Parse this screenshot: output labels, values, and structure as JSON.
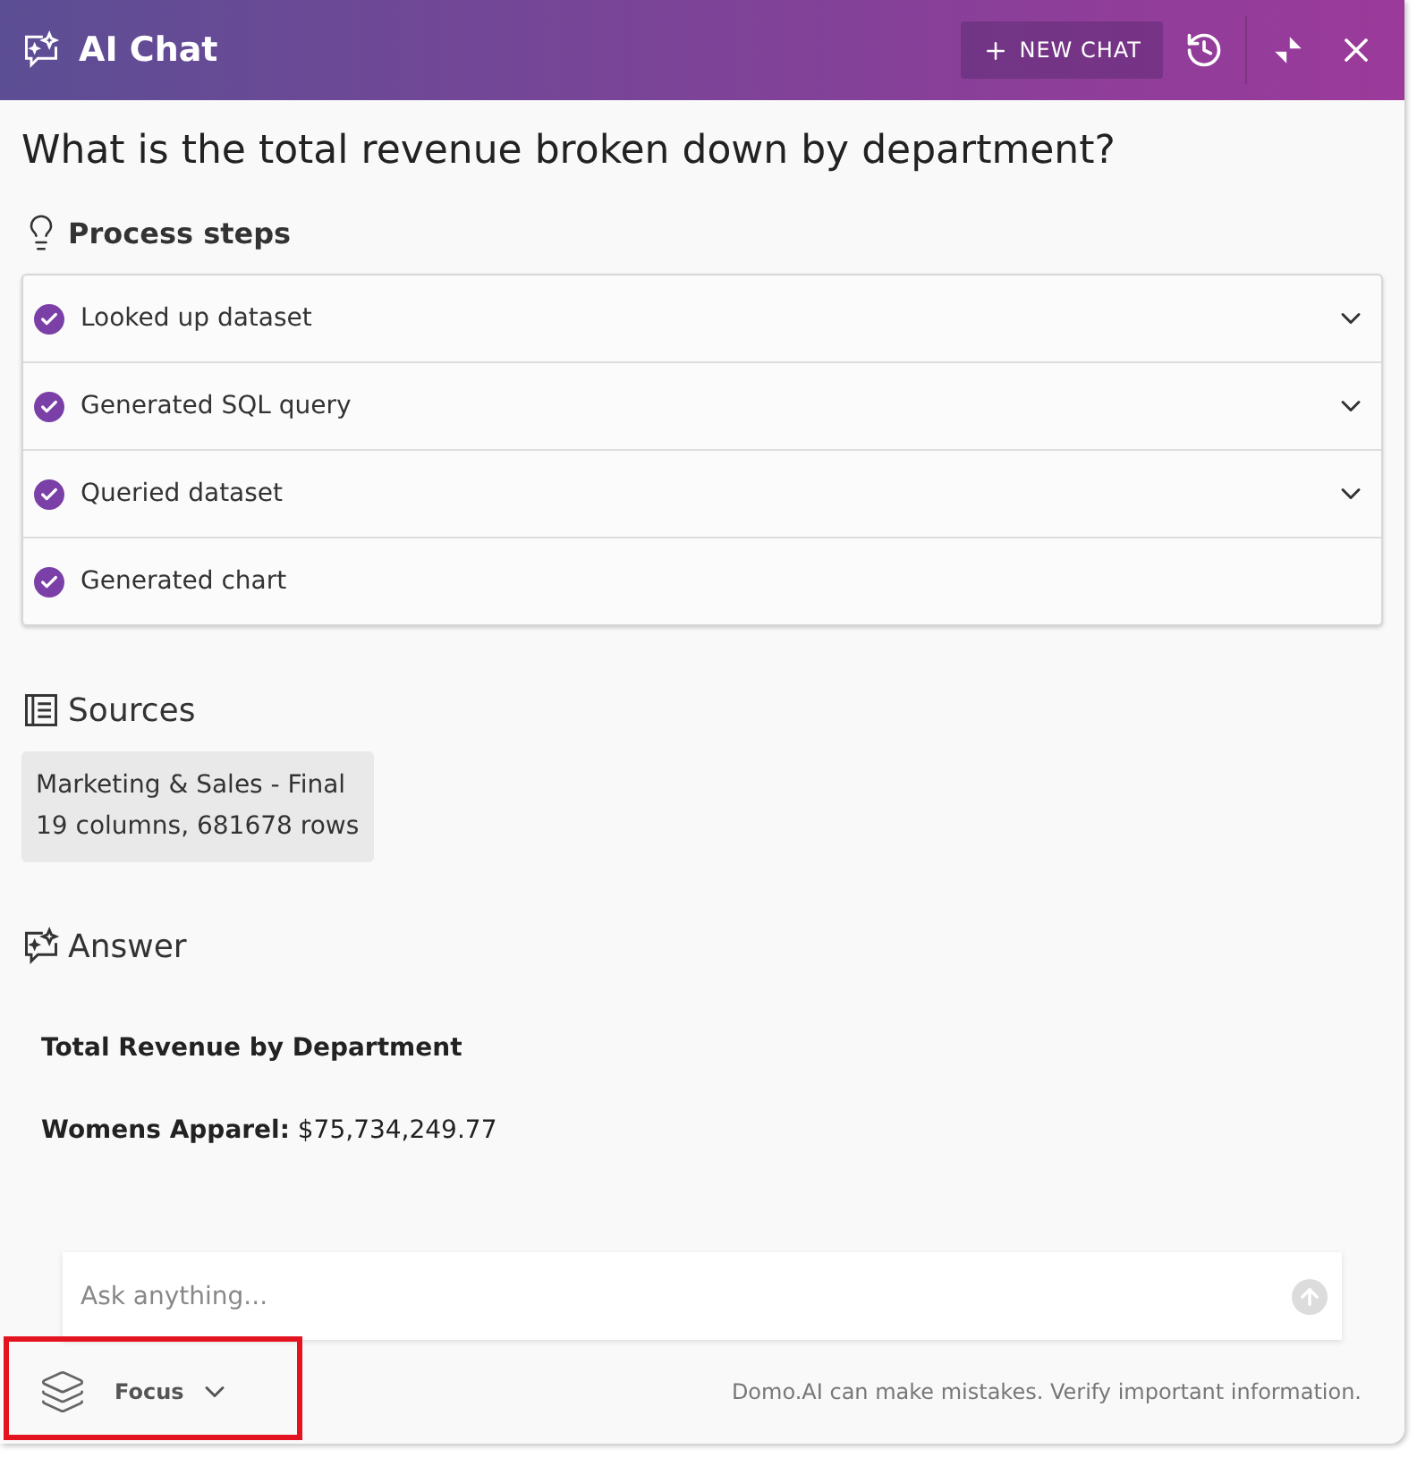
{
  "header": {
    "title": "AI Chat",
    "new_chat_label": "NEW CHAT"
  },
  "question": "What is the total revenue broken down by department?",
  "process": {
    "title": "Process steps",
    "steps": [
      {
        "label": "Looked up dataset",
        "done": true,
        "expandable": true
      },
      {
        "label": "Generated SQL query",
        "done": true,
        "expandable": true
      },
      {
        "label": "Queried dataset",
        "done": true,
        "expandable": true
      },
      {
        "label": "Generated chart",
        "done": true,
        "expandable": false
      }
    ]
  },
  "sources": {
    "title": "Sources",
    "items": [
      {
        "name": "Marketing & Sales - Final",
        "detail": "19 columns, 681678 rows"
      }
    ]
  },
  "answer": {
    "title": "Answer",
    "heading": "Total Revenue by Department",
    "lines": [
      "**Womens Apparel:** $75,734,249.77"
    ]
  },
  "composer": {
    "placeholder": "Ask anything..."
  },
  "footer": {
    "focus_label": "Focus",
    "disclaimer": "Domo.AI can make mistakes. Verify important information."
  }
}
